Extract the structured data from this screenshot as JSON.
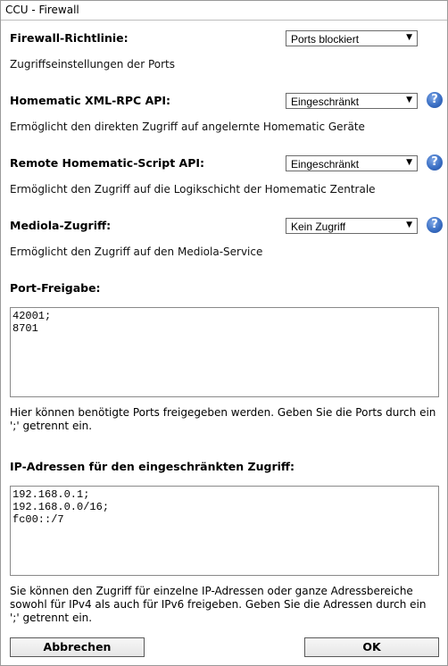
{
  "window": {
    "title": "CCU - Firewall"
  },
  "firewall_policy": {
    "label": "Firewall-Richtlinie:",
    "selected": "Ports blockiert",
    "description": "Zugriffseinstellungen der Ports"
  },
  "xmlrpc": {
    "label": "Homematic XML-RPC API:",
    "selected": "Eingeschränkt",
    "description": "Ermöglicht den direkten Zugriff auf angelernte Homematic Geräte",
    "help": "?"
  },
  "script_api": {
    "label": "Remote Homematic-Script API:",
    "selected": "Eingeschränkt",
    "description": "Ermöglicht den Zugriff auf die Logikschicht der Homematic Zentrale",
    "help": "?"
  },
  "mediola": {
    "label": "Mediola-Zugriff:",
    "selected": "Kein Zugriff",
    "description": "Ermöglicht den Zugriff auf den Mediola-Service",
    "help": "?"
  },
  "ports": {
    "label": "Port-Freigabe:",
    "value": "42001;\n8701",
    "hint": "Hier können benötigte Ports freigegeben werden. Geben Sie die Ports durch ein ';' getrennt ein."
  },
  "ip_addresses": {
    "label": "IP-Adressen für den eingeschränkten Zugriff:",
    "value": "192.168.0.1;\n192.168.0.0/16;\nfc00::/7",
    "hint": "Sie können den Zugriff für einzelne IP-Adressen oder ganze Adressbereiche sowohl für IPv4 als auch für IPv6 freigeben. Geben Sie die Adressen durch ein ';' getrennt ein."
  },
  "buttons": {
    "cancel": "Abbrechen",
    "ok": "OK"
  },
  "icons": {
    "dropdown": "chevron-down-icon",
    "help": "help-icon"
  }
}
